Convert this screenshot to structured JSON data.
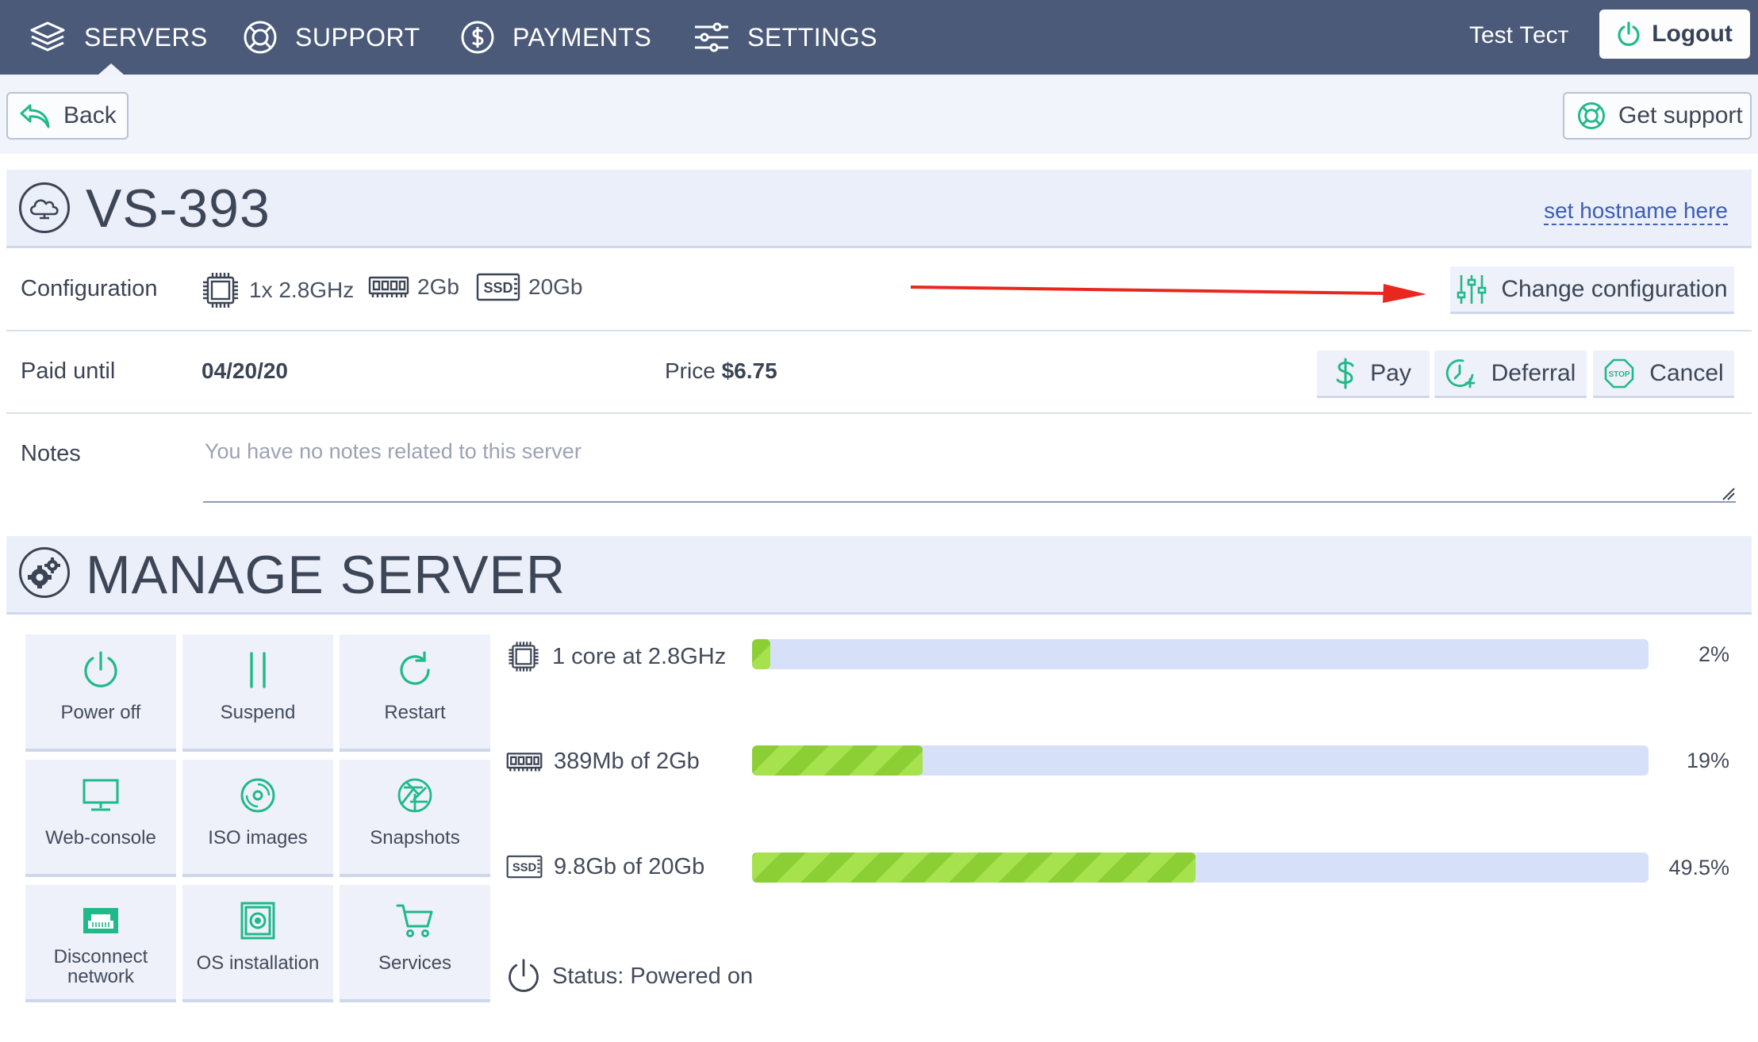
{
  "nav": {
    "items": [
      {
        "label": "SERVERS",
        "icon": "layers-icon"
      },
      {
        "label": "SUPPORT",
        "icon": "lifebuoy-icon"
      },
      {
        "label": "PAYMENTS",
        "icon": "dollar-circle-icon"
      },
      {
        "label": "SETTINGS",
        "icon": "sliders-icon"
      }
    ],
    "user_name": "Test Тест",
    "logout_label": "Logout"
  },
  "toolbar": {
    "back_label": "Back",
    "support_label": "Get support"
  },
  "server": {
    "title": "VS-393",
    "hostname_link": "set hostname here",
    "configuration_label": "Configuration",
    "specs": {
      "cpu": "1x 2.8GHz",
      "ram": "2Gb",
      "disk": "20Gb"
    },
    "change_config_label": "Change configuration",
    "paid_until_label": "Paid until",
    "paid_until_value": "04/20/20",
    "price_label": "Price",
    "price_value": "$6.75",
    "pay_label": "Pay",
    "deferral_label": "Deferral",
    "cancel_label": "Cancel",
    "notes_label": "Notes",
    "notes_placeholder": "You have no notes related to this server"
  },
  "manage": {
    "title": "MANAGE SERVER",
    "tiles": [
      {
        "label": "Power off"
      },
      {
        "label": "Suspend"
      },
      {
        "label": "Restart"
      },
      {
        "label": "Web-console"
      },
      {
        "label": "ISO images"
      },
      {
        "label": "Snapshots"
      },
      {
        "label": "Disconnect network"
      },
      {
        "label": "OS installation"
      },
      {
        "label": "Services"
      }
    ],
    "resources": [
      {
        "label": "1 core at 2.8GHz",
        "percent_label": "2%",
        "fraction": 0.02
      },
      {
        "label": "389Mb of 2Gb",
        "percent_label": "19%",
        "fraction": 0.19
      },
      {
        "label": "9.8Gb of 20Gb",
        "percent_label": "49.5%",
        "fraction": 0.495
      }
    ],
    "status": "Status: Powered on"
  },
  "colors": {
    "accent": "#1fb98a",
    "nav_bg": "#4a5a78",
    "annotation_arrow": "#e8281e",
    "bar_fill": "#9ad842"
  }
}
